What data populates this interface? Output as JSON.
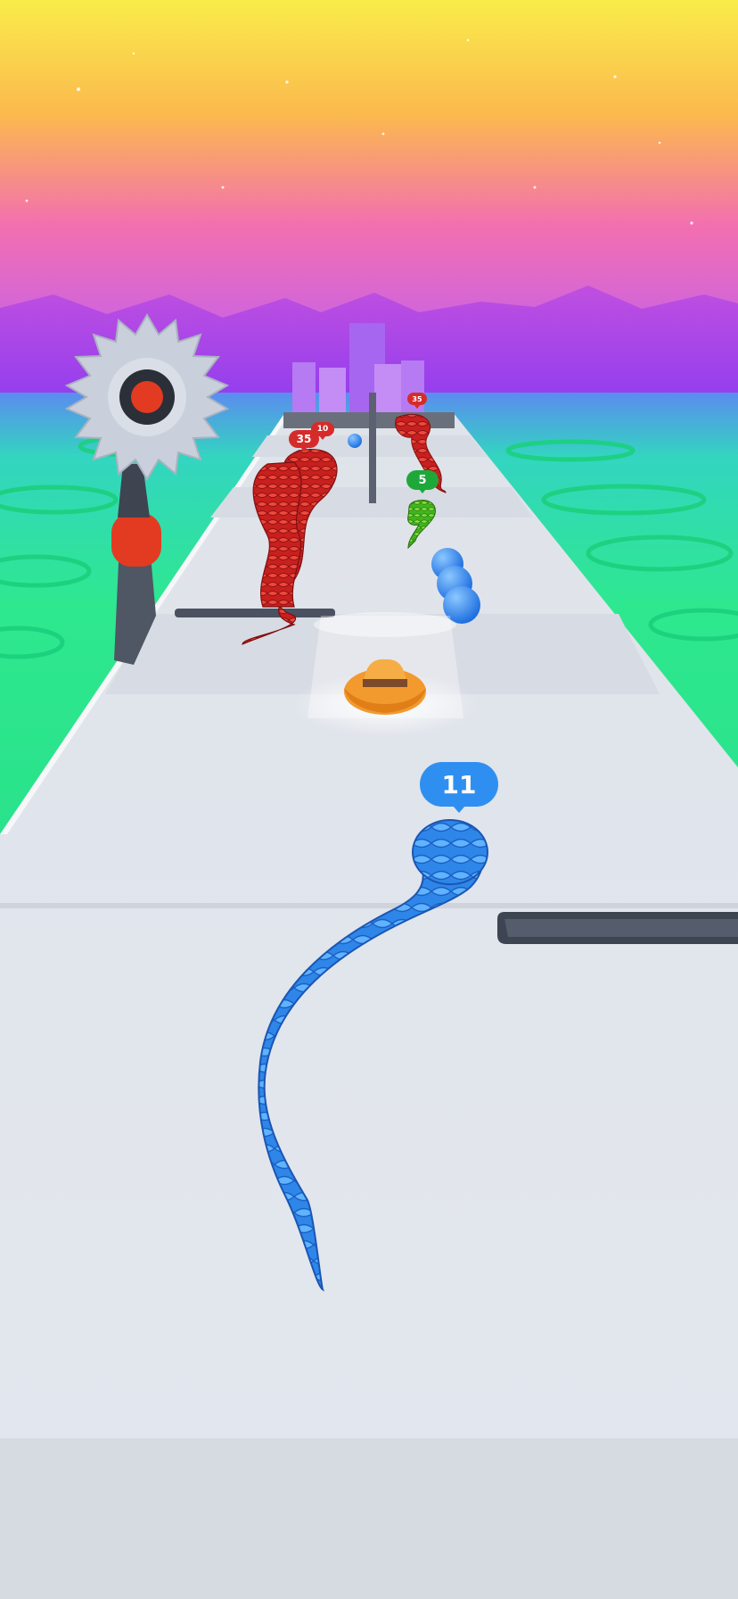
{
  "player": {
    "length": "11",
    "color": "#2f8ff0"
  },
  "enemies": [
    {
      "label": "35",
      "color": "#d62b2b"
    },
    {
      "label": "10",
      "color": "#d62b2b"
    },
    {
      "label": "35",
      "color": "#d62b2b"
    }
  ],
  "ally": {
    "label": "5",
    "color": "#1fa83a"
  },
  "pickup": {
    "icon": "cowboy-hat-icon"
  },
  "colors": {
    "sky_top": "#f9ec4a",
    "sky_mid": "#f36fb0",
    "horizon": "#a94ff0",
    "sea": "#2ee88f",
    "track": "#e6eaf1",
    "saw_blade": "#c9d0dc",
    "saw_hub": "#e23b22"
  }
}
